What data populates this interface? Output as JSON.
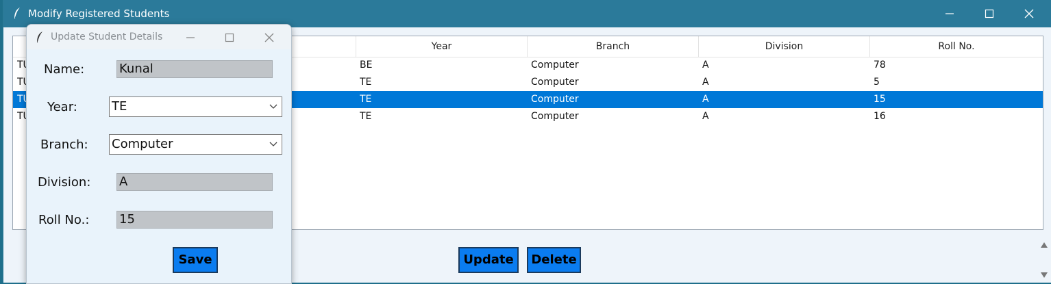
{
  "main_window": {
    "title": "Modify Registered Students"
  },
  "table": {
    "columns": [
      "Year",
      "Branch",
      "Division",
      "Roll No."
    ],
    "rows": [
      {
        "first": "TU",
        "year": "BE",
        "branch": "Computer",
        "division": "A",
        "roll": "78",
        "selected": false
      },
      {
        "first": "TU",
        "year": "TE",
        "branch": "Computer",
        "division": "A",
        "roll": "5",
        "selected": false
      },
      {
        "first": "TU",
        "year": "TE",
        "branch": "Computer",
        "division": "A",
        "roll": "15",
        "selected": true
      },
      {
        "first": "TU",
        "year": "TE",
        "branch": "Computer",
        "division": "A",
        "roll": "16",
        "selected": false
      }
    ]
  },
  "actions": {
    "update_label": "Update",
    "delete_label": "Delete"
  },
  "dialog": {
    "title": "Update Student Details",
    "name_label": "Name:",
    "name_value": "Kunal",
    "year_label": "Year:",
    "year_value": "TE",
    "branch_label": "Branch:",
    "branch_value": "Computer",
    "division_label": "Division:",
    "division_value": "A",
    "roll_label": "Roll No.:",
    "roll_value": "15",
    "save_label": "Save"
  },
  "colors": {
    "titlebar": "#2b7a9a",
    "selection": "#0078d7",
    "button": "#0a7cf0"
  }
}
